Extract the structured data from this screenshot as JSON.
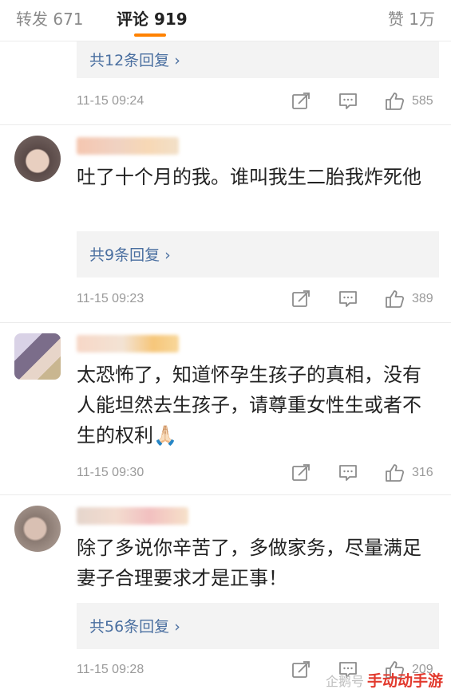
{
  "tabs": {
    "repost": "转发 671",
    "comment": "评论 919",
    "like": "赞 1万"
  },
  "comments": [
    {
      "reply_link": "共12条回复 ›",
      "time": "11-15 09:24",
      "likes": "585"
    },
    {
      "text": "吐了十个月的我。谁叫我生二胎我炸死他",
      "reply_link": "共9条回复 ›",
      "time": "11-15 09:23",
      "likes": "389"
    },
    {
      "text": "太恐怖了，知道怀孕生孩子的真相，没有人能坦然去生孩子，请尊重女性生或者不生的权利🙏🏻",
      "time": "11-15 09:30",
      "likes": "316"
    },
    {
      "text": "除了多说你辛苦了，多做家务，尽量满足妻子合理要求才是正事！",
      "reply_link": "共56条回复 ›",
      "time": "11-15 09:28",
      "likes": "209"
    }
  ],
  "watermark": {
    "prefix": "企鹅号",
    "text": "手动动手游"
  },
  "colors": {
    "accent": "#ff8200",
    "link": "#4a6fa0",
    "meta": "#9a9a9a",
    "reply_bg": "#f3f3f3",
    "watermark": "#e23a2e"
  }
}
